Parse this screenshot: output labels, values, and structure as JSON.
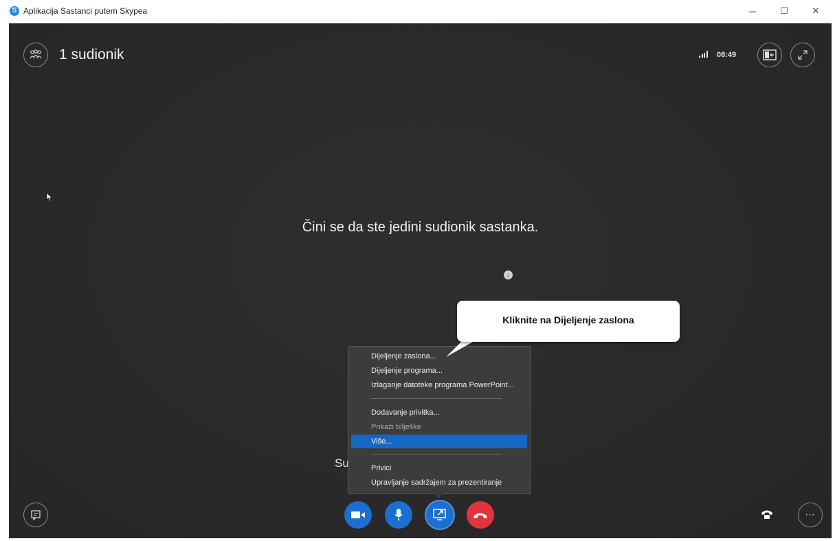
{
  "window": {
    "app_icon_letter": "S",
    "title": "Aplikacija Sastanci putem Skypea",
    "minimize": "−",
    "maximize": "☐",
    "close": "✕"
  },
  "header": {
    "participants_label": "1 sudionik",
    "clock": "08:49"
  },
  "stage": {
    "message": "Čini se da ste jedini sudionik sastanka.",
    "partial_text": "Su"
  },
  "callout": {
    "text": "Kliknite na Dijeljenje zaslona"
  },
  "share_menu": {
    "items": [
      {
        "label": "Dijeljenje zaslona...",
        "state": "normal"
      },
      {
        "label": "Dijeljenje programa...",
        "state": "normal"
      },
      {
        "label": "Izlaganje datoteke programa PowerPoint...",
        "state": "normal"
      },
      {
        "label": "Dodavanje privitka...",
        "state": "normal"
      },
      {
        "label": "Prikaži bilješke",
        "state": "disabled"
      },
      {
        "label": "Više...",
        "state": "selected"
      },
      {
        "label": "Privici",
        "state": "normal"
      },
      {
        "label": "Upravljanje sadržajem za prezentiranje",
        "state": "normal"
      }
    ]
  },
  "controls": {
    "video": "video-camera-icon",
    "mic": "microphone-icon",
    "share": "share-screen-icon",
    "hangup": "hang-up-icon",
    "chat": "chat-icon",
    "phone": "phone-icon",
    "more": "···"
  },
  "colors": {
    "stage_bg": "#2b2b2b",
    "control_blue": "#1a6fd0",
    "hangup_red": "#e2343a",
    "menu_selected": "#1467c4"
  }
}
